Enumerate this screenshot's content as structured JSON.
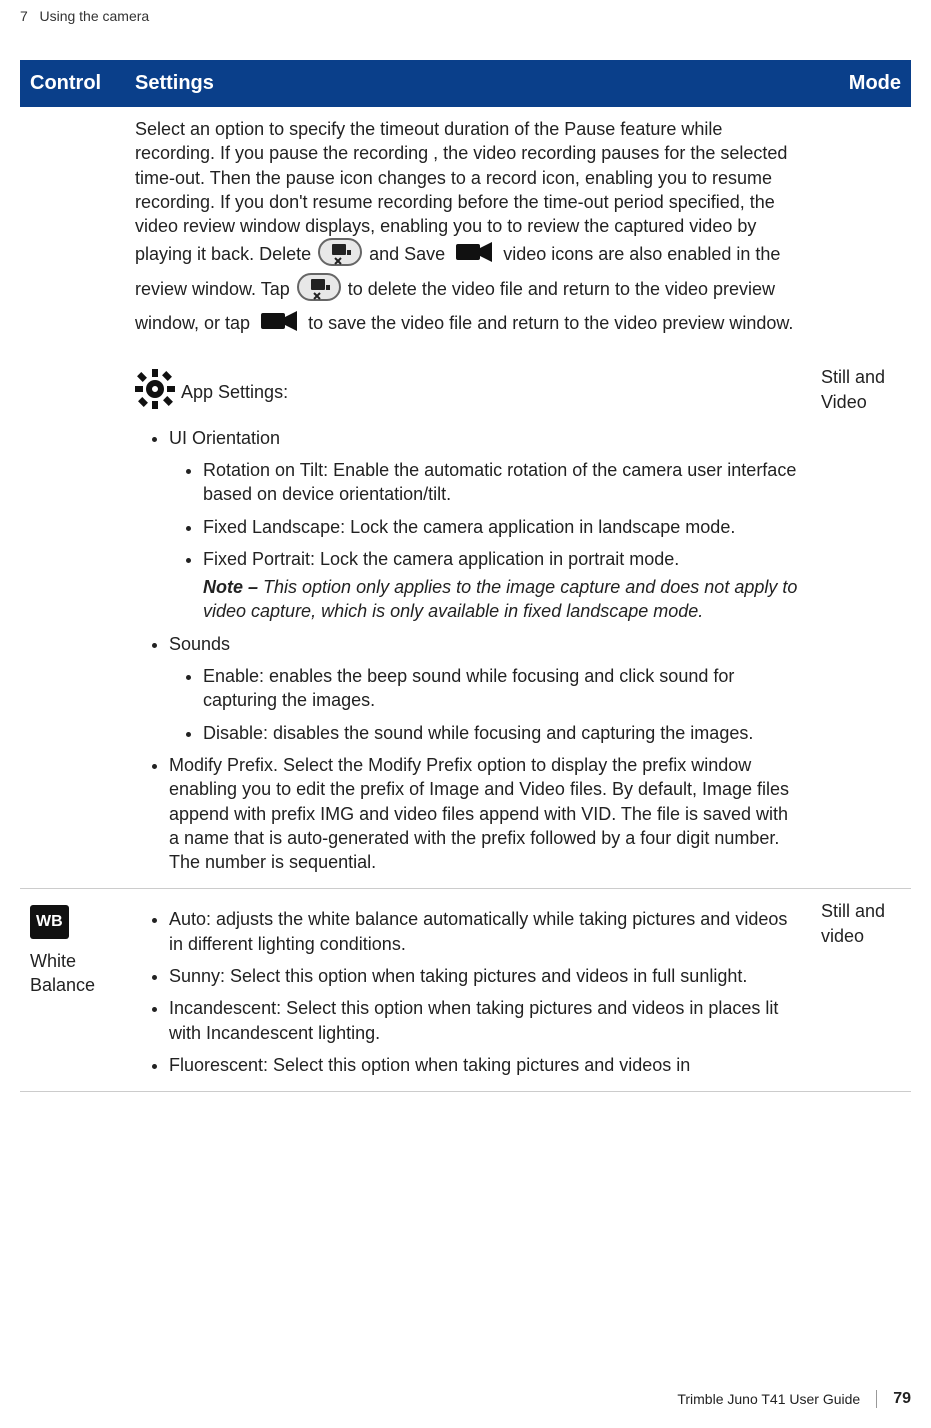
{
  "chapter": {
    "num": "7",
    "title": "Using the camera"
  },
  "table": {
    "headers": {
      "control": "Control",
      "settings": "Settings",
      "mode": "Mode"
    },
    "row1": {
      "t1": "Select an option to specify the timeout duration of the Pause feature while recording. If you pause the recording , the video recording pauses for the selected time-out. Then the pause icon changes to a record icon, enabling you to resume recording. If you don't resume recording before the time-out period specified, the video review window displays, enabling you to to review the captured video by playing it back. Delete ",
      "t2": " and Save ",
      "t3": " video icons are also enabled in the review window. Tap ",
      "t4": " to delete the video file and return to the video preview window, or tap ",
      "t5": " to save the video file and return to the video preview window."
    },
    "row2": {
      "mode": "Still and Video",
      "app_settings_label": "App Settings:",
      "bullets": {
        "ui_orientation": {
          "label": "UI Orientation",
          "sub": {
            "rotation": "Rotation on Tilt: Enable the automatic rotation of the camera user interface based on device orientation/tilt.",
            "landscape": "Fixed Landscape: Lock the camera application in landscape mode.",
            "portrait": "Fixed Portrait: Lock the camera application in portrait mode.",
            "note_label": "Note  –",
            "note_body": " This option only applies to the image capture and does not apply to video capture, which is only available in fixed landscape mode."
          }
        },
        "sounds": {
          "label": "Sounds",
          "sub": {
            "enable": "Enable: enables the beep sound while focusing and click sound for capturing the images.",
            "disable": "Disable: disables the sound while focusing and capturing the images."
          }
        },
        "modify_prefix": "Modify Prefix. Select the Modify Prefix option to display the prefix window enabling you to edit the prefix of Image and Video files. By default, Image files append with prefix IMG and video files append with VID. The file is saved with a name that is auto-generated with the prefix followed by a four digit number. The number is sequential."
      }
    },
    "row3": {
      "wb_icon_text": "WB",
      "control_label": "White Balance",
      "mode": "Still and video",
      "bullets": {
        "auto": "Auto: adjusts the white balance automatically while taking pictures and videos in different lighting conditions.",
        "sunny": "Sunny: Select this option when taking pictures and videos in full sunlight.",
        "incandescent": "Incandescent: Select this option when taking pictures and videos in places lit with Incandescent lighting.",
        "fluorescent": "Fluorescent: Select this option when taking pictures and videos in"
      }
    }
  },
  "footer": {
    "doc": "Trimble Juno T41 User Guide",
    "page": "79"
  }
}
